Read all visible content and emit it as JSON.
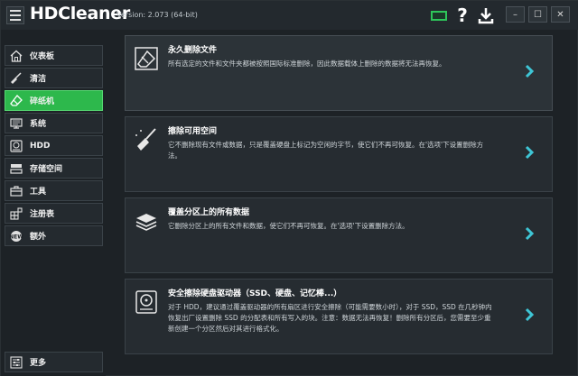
{
  "app": {
    "title": "HDCleaner",
    "version": "Version: 2.073 (64-bit)"
  },
  "window_controls": {
    "minimize": "–",
    "maximize": "☐",
    "close": "✕"
  },
  "toolbar": {
    "help": "?"
  },
  "sidebar": {
    "items": [
      {
        "label": "仪表板",
        "icon": "home-icon"
      },
      {
        "label": "清洁",
        "icon": "broom-icon"
      },
      {
        "label": "碎纸机",
        "icon": "eraser-icon",
        "active": true
      },
      {
        "label": "系统",
        "icon": "system-icon"
      },
      {
        "label": "HDD",
        "icon": "hdd-icon"
      },
      {
        "label": "存储空间",
        "icon": "storage-icon"
      },
      {
        "label": "工具",
        "icon": "toolbox-icon"
      },
      {
        "label": "注册表",
        "icon": "registry-icon"
      },
      {
        "label": "额外",
        "icon": "extra-icon"
      }
    ],
    "more": {
      "label": "更多",
      "icon": "settings-icon"
    }
  },
  "cards": [
    {
      "title": "永久删除文件",
      "desc": "所有选定的文件和文件夹都被按照国际标准删除，因此数据载体上删除的数据将无法再恢复。",
      "icon": "eraser-icon"
    },
    {
      "title": "擦除可用空间",
      "desc": "它不删除现有文件或数据，只是覆盖硬盘上标记为空闲的字节，使它们不再可恢复。在'选项'下设置删除方法。",
      "icon": "broom-icon"
    },
    {
      "title": "覆盖分区上的所有数据",
      "desc": "它删除分区上的所有文件和数据，使它们不再可恢复。在'选项'下设置删除方法。",
      "icon": "partition-icon"
    },
    {
      "title": "安全擦除硬盘驱动器（SSD、硬盘、记忆棒...）",
      "desc": "对于 HDD，建议通过覆盖驱动器的所有扇区进行安全擦除（可能需要数小时），对于 SSD，SSD 在几秒钟内恢复出厂设置删除 SSD 的分配表和所有写入的块。注意：数据无法再恢复！删除所有分区后，您需要至少重新创建一个分区然后对其进行格式化。",
      "icon": "drive-icon"
    }
  ],
  "colors": {
    "accent": "#2db84c",
    "arrow": "#3ec6d6"
  }
}
